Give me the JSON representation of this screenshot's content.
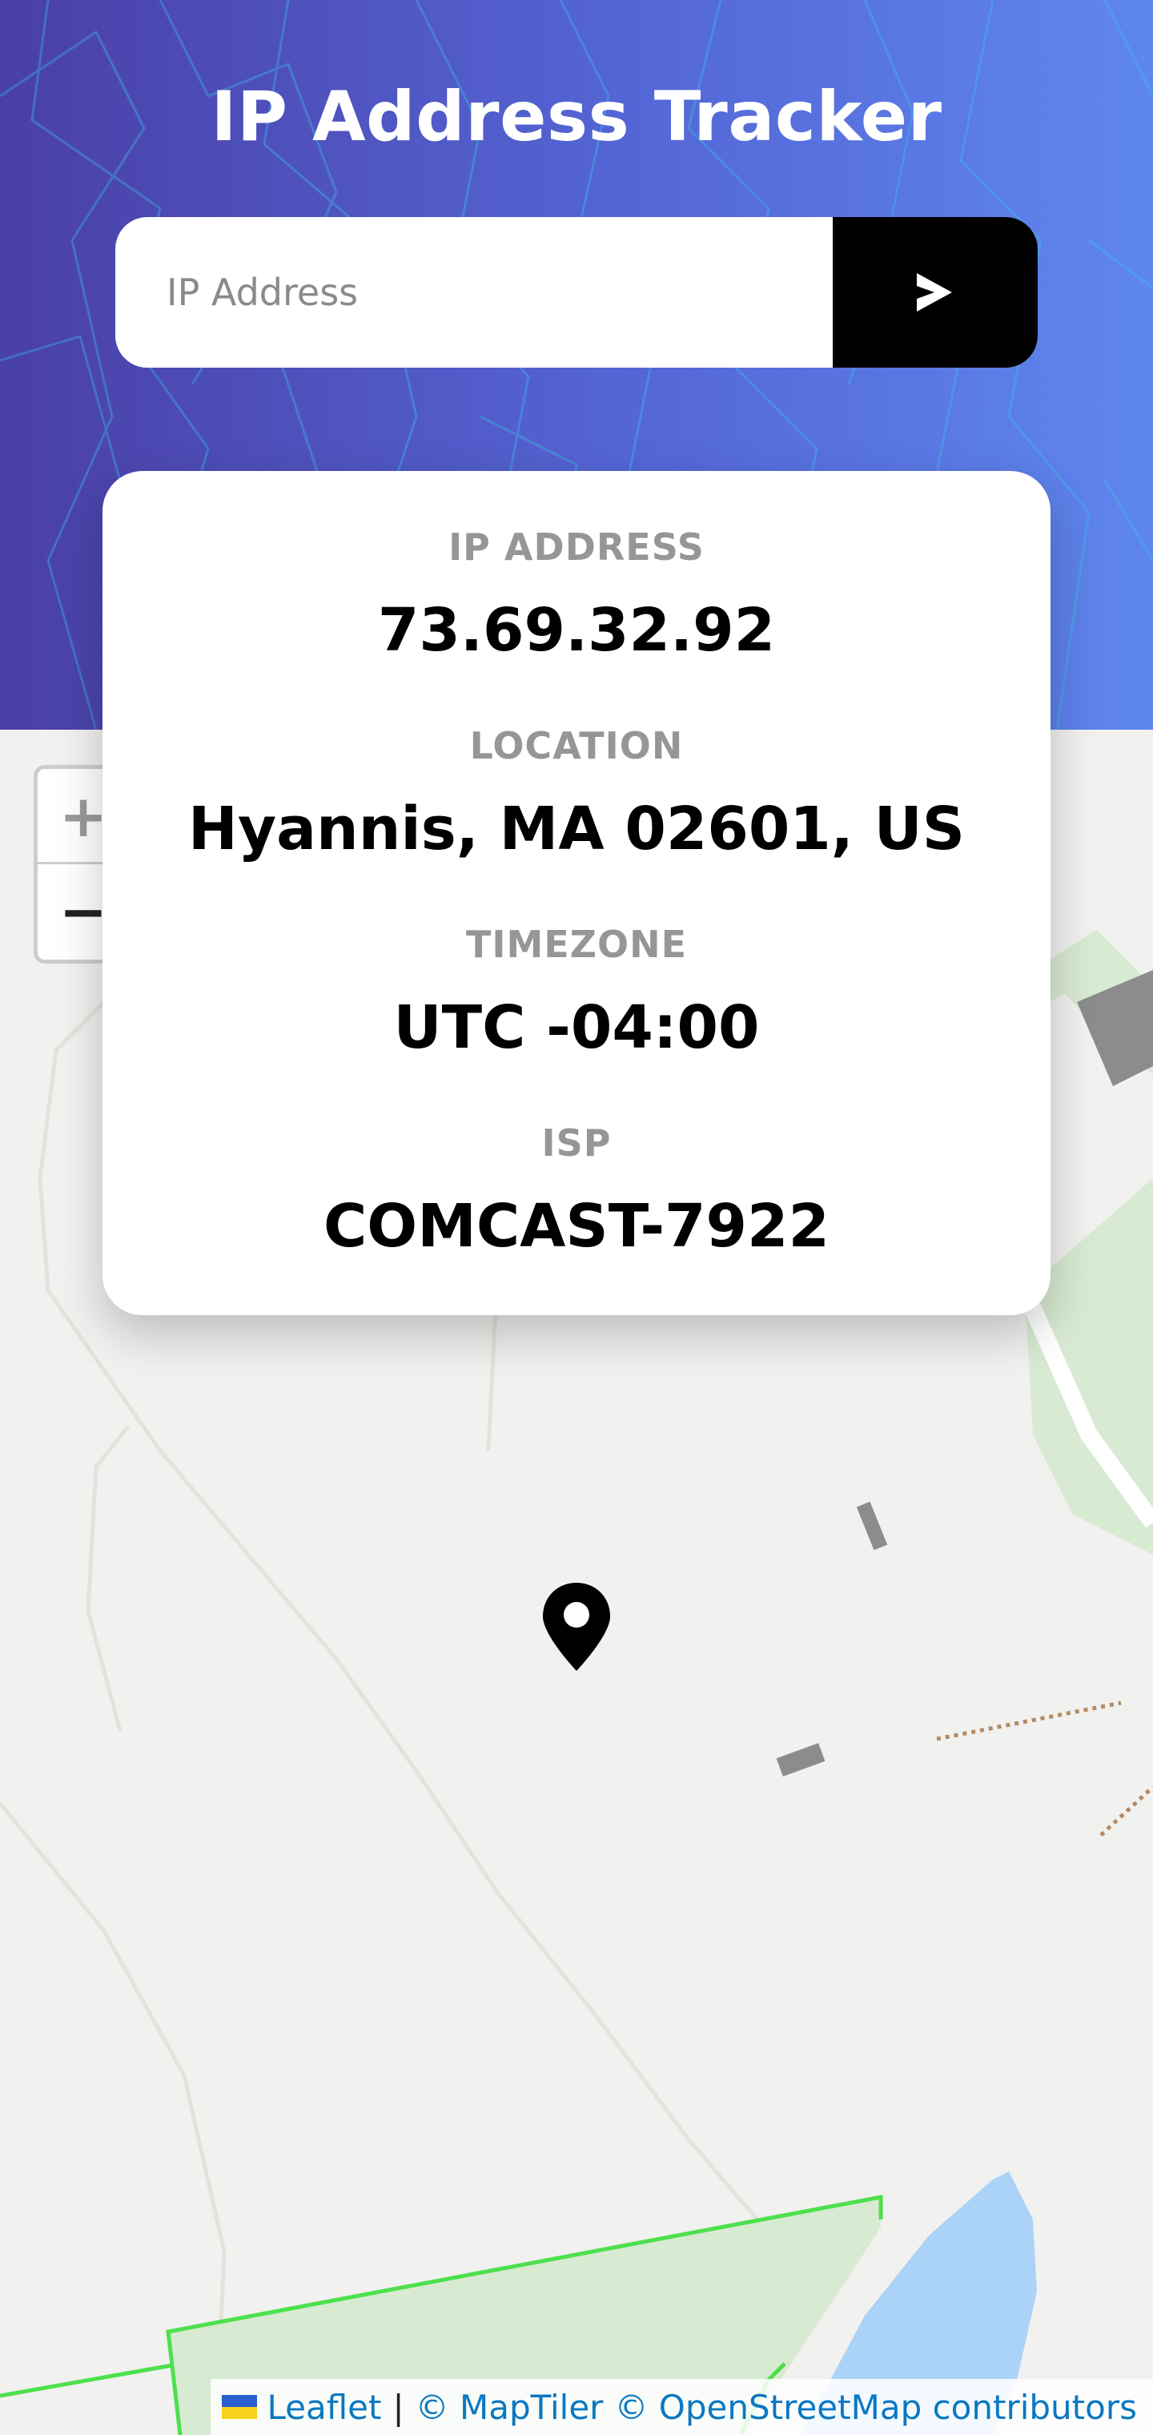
{
  "header": {
    "title": "IP Address Tracker",
    "background_gradient": [
      "#4a3fa6",
      "#5466d6",
      "#5f86ee"
    ]
  },
  "search": {
    "placeholder": "IP Address",
    "value": "",
    "button_icon": "chevron-right-icon",
    "button_color": "#000000"
  },
  "info": {
    "ip_label": "IP ADDRESS",
    "ip_value": "73.69.32.92",
    "location_label": "LOCATION",
    "location_value": "Hyannis, MA 02601, US",
    "timezone_label": "TIMEZONE",
    "timezone_value": "UTC -04:00",
    "isp_label": "ISP",
    "isp_value": "COMCAST-7922"
  },
  "map": {
    "zoom_in_label": "+",
    "zoom_out_label": "−",
    "marker_icon": "location-pin-icon",
    "attribution": {
      "flag_icon": "ukraine-flag-icon",
      "leaflet": "Leaflet",
      "separator": "|",
      "maptiler": "© MapTiler",
      "osm": "© OpenStreetMap contributors"
    }
  }
}
